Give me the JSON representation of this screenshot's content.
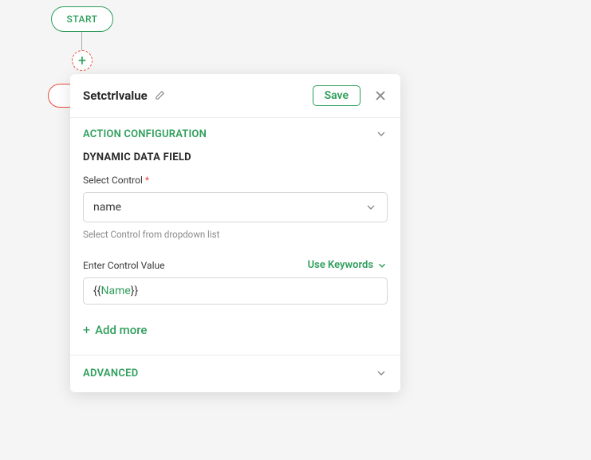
{
  "canvas": {
    "start_label": "START",
    "plus_glyph": "+"
  },
  "panel": {
    "title": "Setctrlvalue",
    "save_label": "Save"
  },
  "config": {
    "section_title": "ACTION CONFIGURATION",
    "subsection_title": "DYNAMIC DATA FIELD",
    "select_label": "Select Control",
    "required_mark": "*",
    "select_value": "name",
    "select_helper": "Select Control from dropdown list",
    "enter_label": "Enter Control Value",
    "use_keywords_label": "Use Keywords",
    "control_value_open": "{{",
    "control_value_inner": "Name",
    "control_value_close": "}}",
    "add_more_label": "Add more",
    "add_more_plus": "+"
  },
  "advanced": {
    "title": "ADVANCED"
  }
}
